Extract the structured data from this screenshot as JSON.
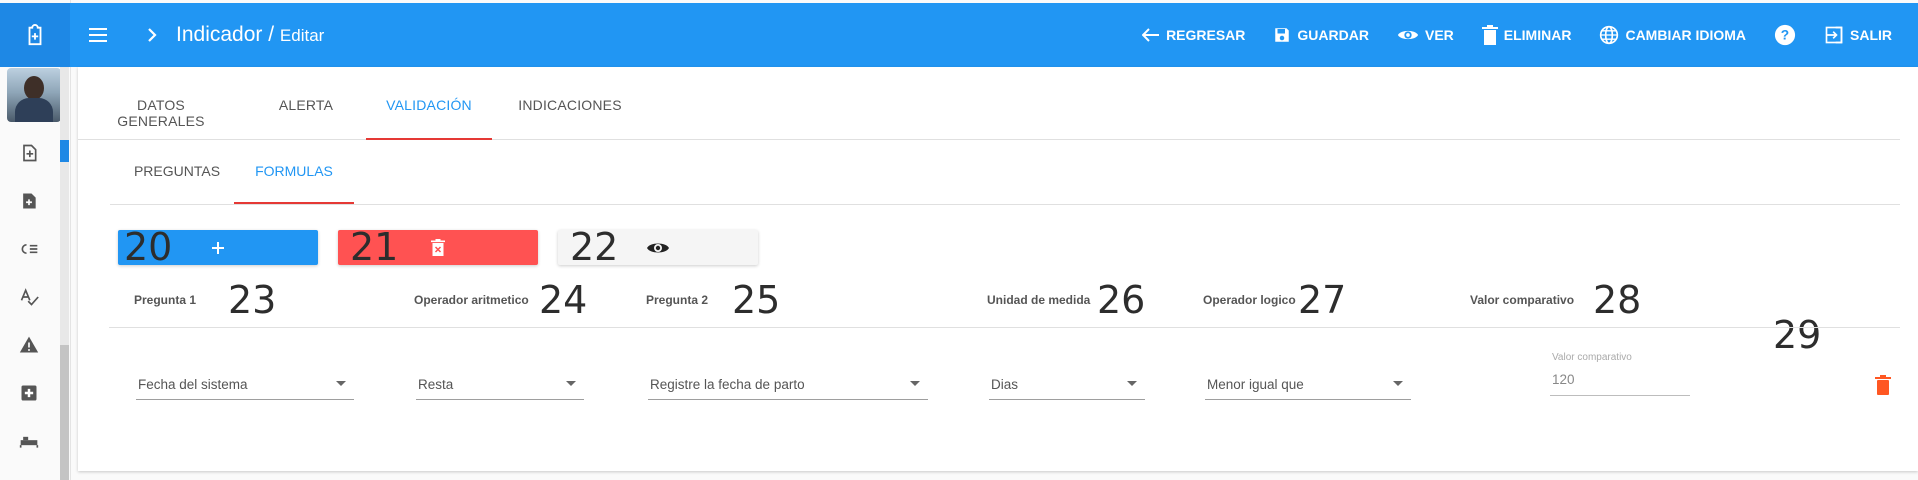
{
  "colors": {
    "primary": "#2196f3",
    "danger": "#ff5252",
    "accent_underline": "#e53935",
    "delete_icon": "#ff5722"
  },
  "header": {
    "title": "Indicador",
    "separator": "/",
    "subtitle": "Editar",
    "actions": [
      {
        "label": "REGRESAR",
        "icon": "arrow-left-icon"
      },
      {
        "label": "GUARDAR",
        "icon": "floppy-disk-icon"
      },
      {
        "label": "VER",
        "icon": "eye-icon"
      },
      {
        "label": "ELIMINAR",
        "icon": "trash-icon"
      },
      {
        "label": "CAMBIAR IDIOMA",
        "icon": "globe-icon"
      },
      {
        "label": "",
        "icon": "help-circle-icon"
      },
      {
        "label": "SALIR",
        "icon": "exit-icon"
      }
    ]
  },
  "sidebar": {
    "icons": [
      "clipboard-plus-icon",
      "file-plus-icon",
      "note-plus-icon",
      "checklist-icon",
      "spellcheck-icon",
      "warning-icon",
      "medical-cross-icon",
      "bed-icon"
    ]
  },
  "tabs": [
    "DATOS GENERALES",
    "ALERTA",
    "VALIDACIÓN",
    "INDICACIONES"
  ],
  "active_tab": "VALIDACIÓN",
  "subtabs": [
    "PREGUNTAS",
    "FORMULAS"
  ],
  "active_subtab": "FORMULAS",
  "action_buttons": [
    {
      "number": "20",
      "icon": "plus-icon"
    },
    {
      "number": "21",
      "icon": "delete-icon"
    },
    {
      "number": "22",
      "icon": "eye-icon"
    }
  ],
  "columns": [
    {
      "label": "Pregunta 1",
      "number": "23"
    },
    {
      "label": "Operador aritmetico",
      "number": "24"
    },
    {
      "label": "Pregunta 2",
      "number": "25"
    },
    {
      "label": "Unidad de medida",
      "number": "26"
    },
    {
      "label": "Operador logico",
      "number": "27"
    },
    {
      "label": "Valor comparativo",
      "number": "28"
    }
  ],
  "delete_column_number": "29",
  "row": {
    "pregunta1": "Fecha del sistema",
    "operador_aritmetico": "Resta",
    "pregunta2": "Registre la fecha de parto",
    "unidad_medida": "Dias",
    "operador_logico": "Menor igual que",
    "valor_label": "Valor comparativo",
    "valor": "120"
  }
}
